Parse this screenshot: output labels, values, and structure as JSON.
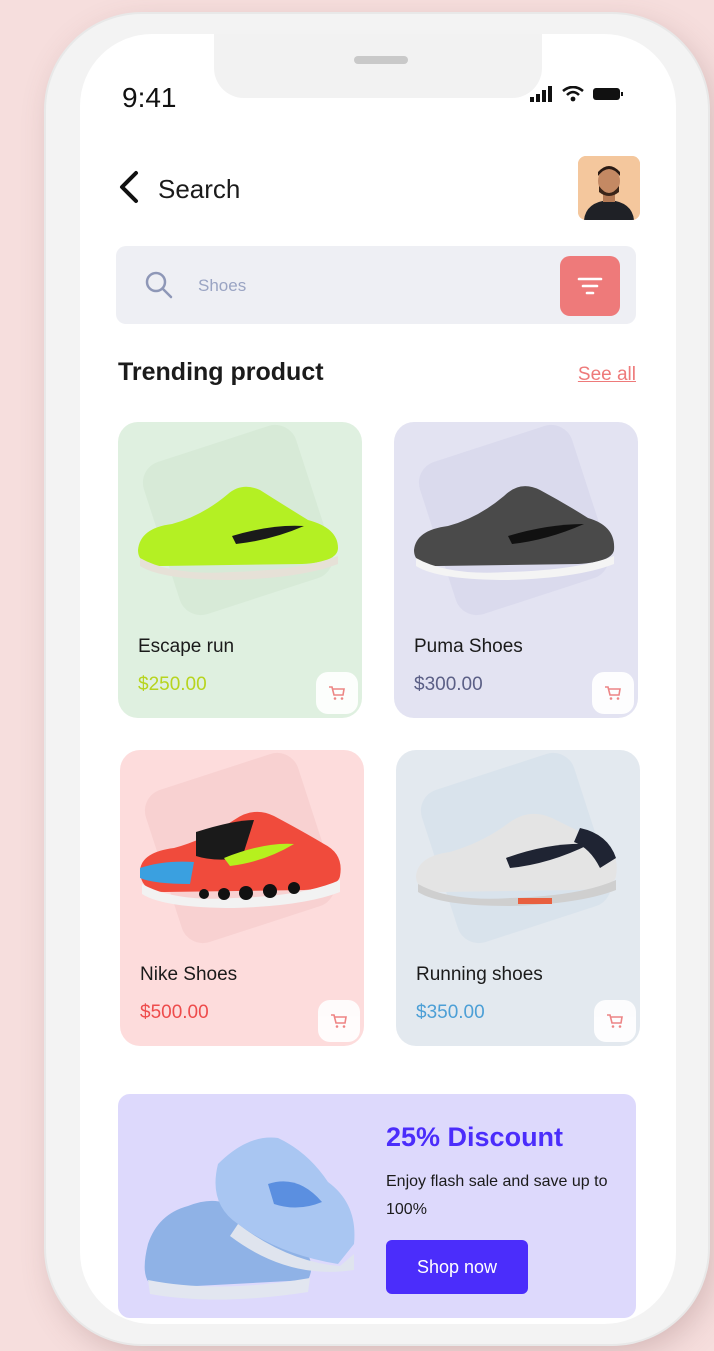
{
  "status_bar": {
    "time": "9:41"
  },
  "header": {
    "title": "Search"
  },
  "search": {
    "placeholder": "Shoes"
  },
  "section": {
    "title": "Trending product",
    "see_all": "See all"
  },
  "products": [
    {
      "name": "Escape run",
      "price": "$250.00",
      "bg": "#dff0e0",
      "price_color": "#b7d41e",
      "shoe_color": "#b4f023"
    },
    {
      "name": "Puma Shoes",
      "price": "$300.00",
      "bg": "#e3e3f2",
      "price_color": "#5b5f86",
      "shoe_color": "#4a4a4a"
    },
    {
      "name": "Nike Shoes",
      "price": "$500.00",
      "bg": "#fddcdc",
      "price_color": "#ee4c4c",
      "shoe_color": "#f04b3c"
    },
    {
      "name": "Running shoes",
      "price": "$350.00",
      "bg": "#e3e9ef",
      "price_color": "#4c9fd6",
      "shoe_color": "#e4e4e4"
    }
  ],
  "promo": {
    "title": "25% Discount",
    "text": "Enjoy flash sale and save up to 100%",
    "button": "Shop now"
  },
  "colors": {
    "accent": "#ee7a7a",
    "brand": "#4b2dfb"
  }
}
